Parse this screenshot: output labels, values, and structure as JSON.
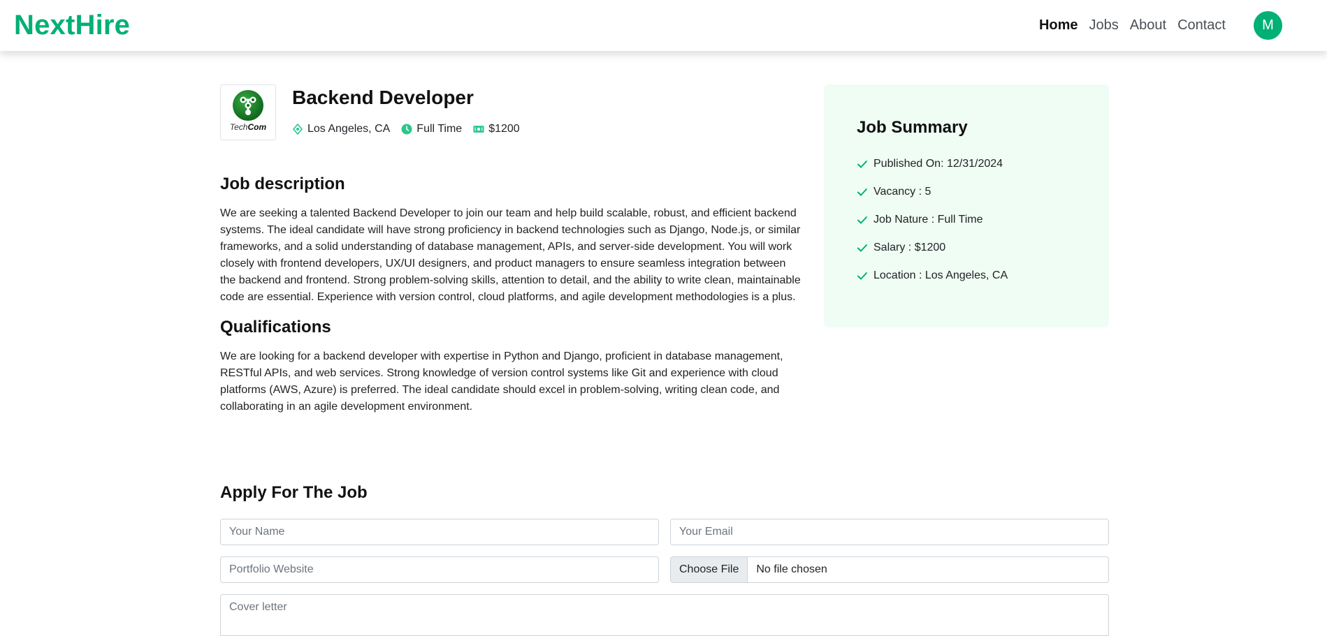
{
  "navbar": {
    "brand": "NextHire",
    "links": [
      "Home",
      "Jobs",
      "About",
      "Contact"
    ],
    "avatar_initial": "M"
  },
  "job": {
    "company_logo_text_prefix": "Tech",
    "company_logo_text_suffix": "Com",
    "title": "Backend Developer",
    "location": "Los Angeles, CA",
    "type": "Full Time",
    "salary": "$1200"
  },
  "description": {
    "heading": "Job description",
    "text": "We are seeking a talented Backend Developer to join our team and help build scalable, robust, and efficient backend systems. The ideal candidate will have strong proficiency in backend technologies such as Django, Node.js, or similar frameworks, and a solid understanding of database management, APIs, and server-side development. You will work closely with frontend developers, UX/UI designers, and product managers to ensure seamless integration between the backend and frontend. Strong problem-solving skills, attention to detail, and the ability to write clean, maintainable code are essential. Experience with version control, cloud platforms, and agile development methodologies is a plus."
  },
  "qualifications": {
    "heading": "Qualifications",
    "text": "We are looking for a backend developer with expertise in Python and Django, proficient in database management, RESTful APIs, and web services. Strong knowledge of version control systems like Git and experience with cloud platforms (AWS, Azure) is preferred. The ideal candidate should excel in problem-solving, writing clean code, and collaborating in an agile development environment."
  },
  "summary": {
    "title": "Job Summary",
    "items": [
      "Published On: 12/31/2024",
      "Vacancy : 5",
      "Job Nature : Full Time",
      "Salary : $1200",
      "Location : Los Angeles, CA"
    ]
  },
  "apply": {
    "title": "Apply For The Job",
    "name_placeholder": "Your Name",
    "email_placeholder": "Your Email",
    "portfolio_placeholder": "Portfolio Website",
    "file_button": "Choose File",
    "file_status": "No file chosen",
    "cover_placeholder": "Cover letter"
  },
  "colors": {
    "brand": "#00b074",
    "summary_bg": "#effdf5",
    "icon_accent": "#29c78a"
  },
  "icons": {
    "location": "location-pin-icon",
    "type": "clock-icon",
    "salary": "money-icon",
    "check": "check-icon"
  }
}
